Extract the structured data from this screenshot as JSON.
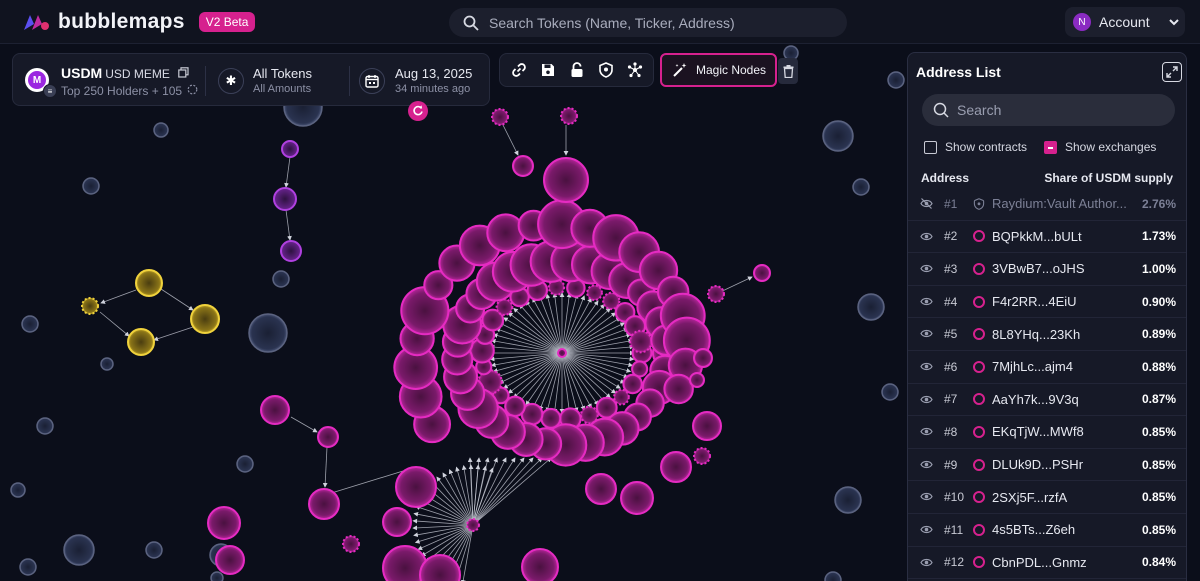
{
  "header": {
    "brand": "bubblemaps",
    "beta_badge": "V2 Beta",
    "search_placeholder": "Search Tokens (Name, Ticker, Address)",
    "account_label": "Account",
    "account_initial": "N"
  },
  "token": {
    "ticker": "USDM",
    "full_name": "USD MEME",
    "logo_letter": "M",
    "holders_label": "Top 250 Holders + 105",
    "filter_main": "All Tokens",
    "filter_sub": "All Amounts",
    "date_main": "Aug 13, 2025",
    "date_sub": "34 minutes ago"
  },
  "toolbar": {
    "icons": [
      "link-icon",
      "save-icon",
      "lock-icon",
      "shield-icon",
      "network-icon"
    ],
    "magic_label": "Magic Nodes"
  },
  "address_list": {
    "title": "Address List",
    "search_placeholder": "Search",
    "show_contracts": "Show contracts",
    "show_exchanges": "Show exchanges",
    "col_address": "Address",
    "col_share": "Share of USDM supply",
    "rows": [
      {
        "rank": "#1",
        "address": "Raydium:Vault Author...",
        "share": "2.76%",
        "contract": true
      },
      {
        "rank": "#2",
        "address": "BQPkkM...bULt",
        "share": "1.73%"
      },
      {
        "rank": "#3",
        "address": "3VBwB7...oJHS",
        "share": "1.00%"
      },
      {
        "rank": "#4",
        "address": "F4r2RR...4EiU",
        "share": "0.90%"
      },
      {
        "rank": "#5",
        "address": "8L8YHq...23Kh",
        "share": "0.89%"
      },
      {
        "rank": "#6",
        "address": "7MjhLc...ajm4",
        "share": "0.88%"
      },
      {
        "rank": "#7",
        "address": "AaYh7k...9V3q",
        "share": "0.87%"
      },
      {
        "rank": "#8",
        "address": "EKqTjW...MWf8",
        "share": "0.85%"
      },
      {
        "rank": "#9",
        "address": "DLUk9D...PSHr",
        "share": "0.85%"
      },
      {
        "rank": "#10",
        "address": "2SXj5F...rzfA",
        "share": "0.85%"
      },
      {
        "rank": "#11",
        "address": "4s5BTs...Z6eh",
        "share": "0.85%"
      },
      {
        "rank": "#12",
        "address": "CbnPDL...Gnmz",
        "share": "0.84%"
      }
    ]
  },
  "colors": {
    "accent": "#d6218e",
    "bubble_pink": "#e52bc2",
    "bubble_yellow": "#f0d23c",
    "bubble_purple": "#b040e0",
    "bubble_gray": "#5b6380"
  }
}
